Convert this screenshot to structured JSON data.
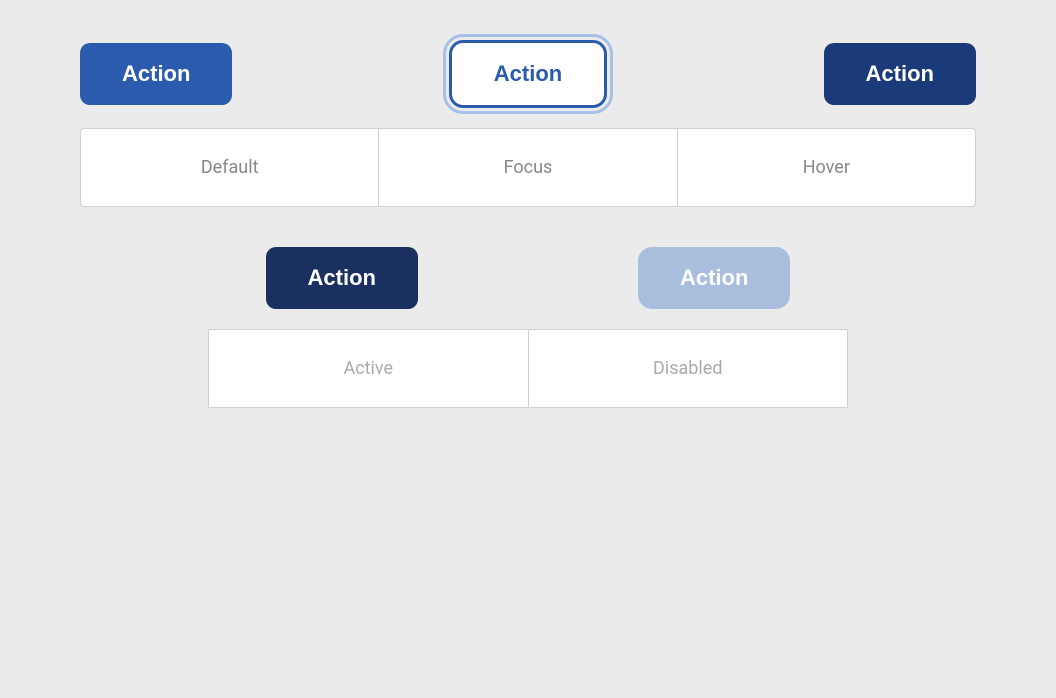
{
  "page": {
    "background": "#ebebeb"
  },
  "row1": {
    "btn_default_label": "Action",
    "btn_focus_label": "Action",
    "btn_hover_label": "Action"
  },
  "row2": {
    "label_default": "Default",
    "label_focus": "Focus",
    "label_hover": "Hover"
  },
  "row3": {
    "btn_active_label": "Action",
    "btn_disabled_label": "Action"
  },
  "row4": {
    "label_active": "Active",
    "label_disabled": "Disabled"
  }
}
